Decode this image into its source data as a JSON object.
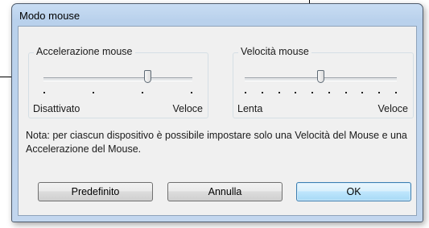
{
  "window": {
    "title": "Modo mouse"
  },
  "acceleration": {
    "label": "Accelerazione mouse",
    "min_label": "Disattivato",
    "max_label": "Veloce",
    "tick_count": 4,
    "value_fraction": 0.7
  },
  "speed": {
    "label": "Velocità mouse",
    "min_label": "Lenta",
    "max_label": "Veloce",
    "tick_count": 10,
    "value_fraction": 0.5
  },
  "note": "Nota: per ciascun dispositivo è possibile impostare solo una Velocità del Mouse e una Accelerazione del Mouse.",
  "buttons": {
    "default_label": "Predefinito",
    "cancel_label": "Annulla",
    "ok_label": "OK"
  },
  "colors": {
    "title_bar": "#c9ddf3",
    "client_bg": "#f0f0f0",
    "ok_button_highlight": "#bee6fd"
  }
}
